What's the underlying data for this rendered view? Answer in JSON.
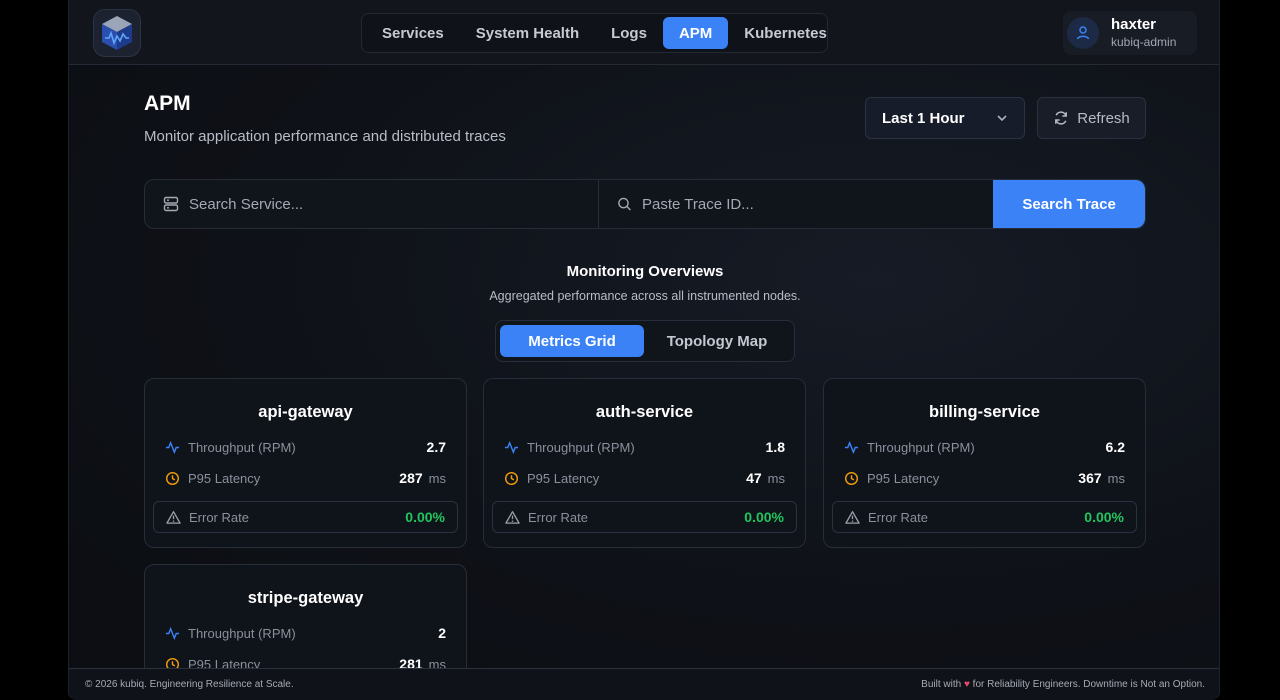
{
  "user": {
    "name": "haxter",
    "role": "kubiq-admin"
  },
  "nav": {
    "items": [
      {
        "label": "Services",
        "active": false
      },
      {
        "label": "System Health",
        "active": false
      },
      {
        "label": "Logs",
        "active": false
      },
      {
        "label": "APM",
        "active": true
      },
      {
        "label": "Kubernetes",
        "active": false
      }
    ]
  },
  "page": {
    "title": "APM",
    "subtitle": "Monitor application performance and distributed traces"
  },
  "controls": {
    "time_range": "Last 1 Hour",
    "refresh_label": "Refresh"
  },
  "search": {
    "service_placeholder": "Search Service...",
    "trace_placeholder": "Paste Trace ID...",
    "button_label": "Search Trace"
  },
  "overview": {
    "title": "Monitoring Overviews",
    "subtitle": "Aggregated performance across all instrumented nodes.",
    "tabs": [
      {
        "label": "Metrics Grid",
        "active": true
      },
      {
        "label": "Topology Map",
        "active": false
      }
    ]
  },
  "labels": {
    "throughput": "Throughput (RPM)",
    "latency": "P95 Latency",
    "latency_unit": "ms",
    "error_rate": "Error Rate"
  },
  "services": [
    {
      "name": "api-gateway",
      "throughput": "2.7",
      "latency": "287",
      "error_rate": "0.00%"
    },
    {
      "name": "auth-service",
      "throughput": "1.8",
      "latency": "47",
      "error_rate": "0.00%"
    },
    {
      "name": "billing-service",
      "throughput": "6.2",
      "latency": "367",
      "error_rate": "0.00%"
    },
    {
      "name": "stripe-gateway",
      "throughput": "2",
      "latency": "281",
      "error_rate": ""
    }
  ],
  "footer": {
    "left": "© 2026 kubiq. Engineering Resilience at Scale.",
    "right_prefix": "Built with",
    "right_suffix": "for Reliability Engineers. Downtime is Not an Option."
  },
  "colors": {
    "accent": "#3b82f6",
    "success": "#22c55e",
    "warning": "#f59e0b",
    "heart": "#e84a6f"
  }
}
